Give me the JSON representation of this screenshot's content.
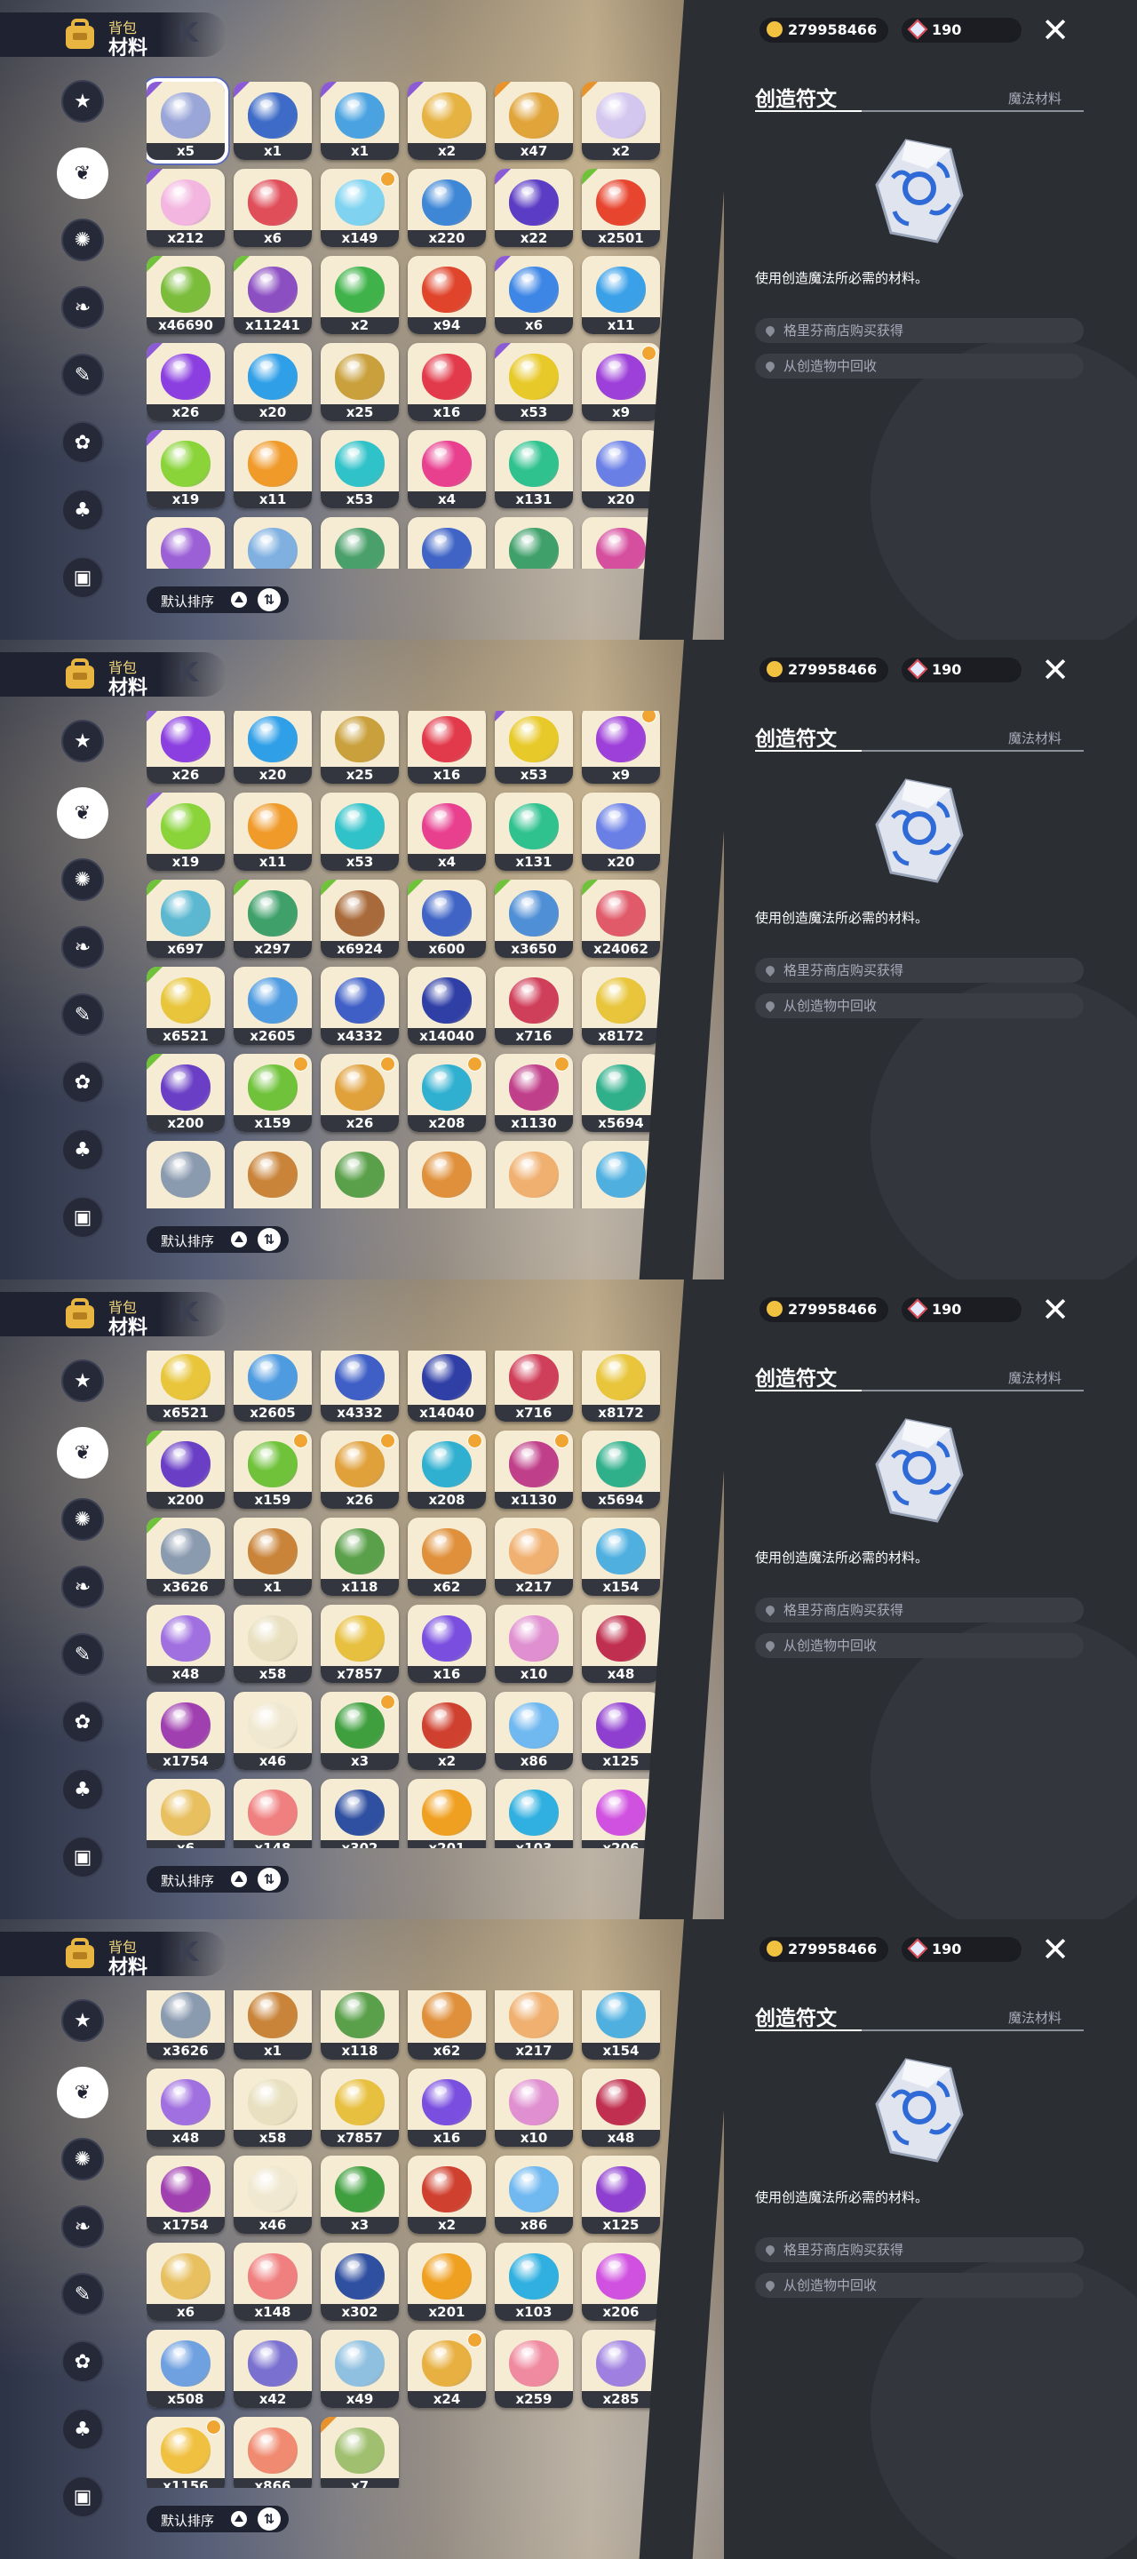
{
  "header": {
    "title_small": "背包",
    "title_main": "材料",
    "title_deco": "K"
  },
  "categories": [
    "star-category-icon",
    "leaf-category-icon",
    "gear-flower-category-icon",
    "plant-category-icon",
    "scroll-category-icon",
    "pet-category-icon",
    "acorn-category-icon",
    "chest-category-icon"
  ],
  "sort": {
    "label": "默认排序"
  },
  "currency": {
    "coins": "279958466",
    "gems": "190"
  },
  "detail": {
    "name": "创造符文",
    "category": "魔法材料",
    "description": "使用创造魔法所必需的材料。",
    "sources": [
      "格里芬商店购买获得",
      "从创造物中回收"
    ]
  },
  "colors": {
    "accent": "#f0c240",
    "panel": "#2b2e33",
    "rarity_purple": "#8b5bd6",
    "rarity_orange": "#e8922c",
    "rarity_green": "#6fc23a"
  },
  "panels": [
    {
      "items": [
        {
          "count": "x5",
          "color": "#9aa6d8",
          "sel": true,
          "rar": "#8b5bd6"
        },
        {
          "count": "x1",
          "color": "#3d6bc7",
          "rar": "#8b5bd6"
        },
        {
          "count": "x1",
          "color": "#4aa3e0",
          "rar": "#8b5bd6"
        },
        {
          "count": "x2",
          "color": "#e6b343",
          "rar": "#8b5bd6"
        },
        {
          "count": "x47",
          "color": "#e0a43a",
          "rar": "#e8922c"
        },
        {
          "count": "x2",
          "color": "#d3c6ef",
          "rar": "#e8922c"
        },
        {
          "count": "x212",
          "color": "#f3b6e0",
          "rar": "#8b5bd6"
        },
        {
          "count": "x6",
          "color": "#e04e5a"
        },
        {
          "count": "x149",
          "color": "#7fd3f0",
          "flag": true
        },
        {
          "count": "x220",
          "color": "#3e86d6"
        },
        {
          "count": "x22",
          "color": "#5b3cc4",
          "rar": "#8b5bd6"
        },
        {
          "count": "x2501",
          "color": "#e8452f",
          "rar": "#6fc23a"
        },
        {
          "count": "x46690",
          "color": "#7bbd3b",
          "rar": "#6fc23a"
        },
        {
          "count": "x11241",
          "color": "#8c4fc2",
          "rar": "#6fc23a"
        },
        {
          "count": "x2",
          "color": "#3fb34a"
        },
        {
          "count": "x94",
          "color": "#e0452c"
        },
        {
          "count": "x6",
          "color": "#3e86e6",
          "rar": "#8b5bd6"
        },
        {
          "count": "x11",
          "color": "#3aa0e8"
        },
        {
          "count": "x26",
          "color": "#8b3fe0",
          "rar": "#8b5bd6"
        },
        {
          "count": "x20",
          "color": "#2f9fe8"
        },
        {
          "count": "x25",
          "color": "#c9a03b"
        },
        {
          "count": "x16",
          "color": "#e23a4a"
        },
        {
          "count": "x53",
          "color": "#e8c92a",
          "rar": "#8b5bd6"
        },
        {
          "count": "x9",
          "color": "#9d3fd9",
          "flag": true
        },
        {
          "count": "x19",
          "color": "#8ad43a",
          "rar": "#8b5bd6"
        },
        {
          "count": "x11",
          "color": "#f09a2a"
        },
        {
          "count": "x53",
          "color": "#2fc2c8"
        },
        {
          "count": "x4",
          "color": "#e83f8f"
        },
        {
          "count": "x131",
          "color": "#2fc28f"
        },
        {
          "count": "x20",
          "color": "#6a7fe6"
        },
        {
          "count": "",
          "color": "#9b5fd6"
        },
        {
          "count": "",
          "color": "#7fb0e0"
        },
        {
          "count": "",
          "color": "#4aa06a"
        },
        {
          "count": "",
          "color": "#3f64c6"
        },
        {
          "count": "",
          "color": "#3fa06a"
        },
        {
          "count": "",
          "color": "#d64f9f"
        }
      ]
    },
    {
      "items": [
        {
          "count": "x26",
          "color": "#8b3fe0",
          "rar": "#8b5bd6"
        },
        {
          "count": "x20",
          "color": "#2f9fe8"
        },
        {
          "count": "x25",
          "color": "#c9a03b"
        },
        {
          "count": "x16",
          "color": "#e23a4a"
        },
        {
          "count": "x53",
          "color": "#e8c92a",
          "rar": "#8b5bd6"
        },
        {
          "count": "x9",
          "color": "#9d3fd9",
          "flag": true
        },
        {
          "count": "x19",
          "color": "#8ad43a",
          "rar": "#8b5bd6"
        },
        {
          "count": "x11",
          "color": "#f09a2a"
        },
        {
          "count": "x53",
          "color": "#2fc2c8"
        },
        {
          "count": "x4",
          "color": "#e83f8f"
        },
        {
          "count": "x131",
          "color": "#2fc28f"
        },
        {
          "count": "x20",
          "color": "#6a7fe6"
        },
        {
          "count": "x697",
          "color": "#5bb8d0",
          "rar": "#6fc23a"
        },
        {
          "count": "x297",
          "color": "#3fa06a",
          "rar": "#6fc23a"
        },
        {
          "count": "x6924",
          "color": "#a86a3a",
          "rar": "#6fc23a"
        },
        {
          "count": "x600",
          "color": "#3f64c6",
          "rar": "#6fc23a"
        },
        {
          "count": "x3650",
          "color": "#4f8fd6",
          "rar": "#6fc23a"
        },
        {
          "count": "x24062",
          "color": "#e05a6a",
          "rar": "#6fc23a"
        },
        {
          "count": "x6521",
          "color": "#e8c53a",
          "rar": "#6fc23a"
        },
        {
          "count": "x2605",
          "color": "#4f9be0"
        },
        {
          "count": "x4332",
          "color": "#3f5fc6"
        },
        {
          "count": "x14040",
          "color": "#2f3fa6"
        },
        {
          "count": "x716",
          "color": "#d03f5a"
        },
        {
          "count": "x8172",
          "color": "#e8c53a"
        },
        {
          "count": "x200",
          "color": "#6a3fc6",
          "rar": "#6fc23a"
        },
        {
          "count": "x159",
          "color": "#6fc23a",
          "flag": true
        },
        {
          "count": "x26",
          "color": "#e0a03a",
          "flag": true
        },
        {
          "count": "x208",
          "color": "#2fb0d0",
          "flag": true
        },
        {
          "count": "x1130",
          "color": "#c03f8a",
          "flag": true
        },
        {
          "count": "x5694",
          "color": "#2fb08a"
        },
        {
          "count": "",
          "color": "#8a9aaf"
        },
        {
          "count": "",
          "color": "#c9843a"
        },
        {
          "count": "",
          "color": "#5aa04a"
        },
        {
          "count": "",
          "color": "#e0903a"
        },
        {
          "count": "",
          "color": "#f0b070"
        },
        {
          "count": "",
          "color": "#4fb0e0"
        }
      ]
    },
    {
      "items": [
        {
          "count": "x6521",
          "color": "#e8c53a"
        },
        {
          "count": "x2605",
          "color": "#4f9be0"
        },
        {
          "count": "x4332",
          "color": "#3f5fc6"
        },
        {
          "count": "x14040",
          "color": "#2f3fa6"
        },
        {
          "count": "x716",
          "color": "#d03f5a"
        },
        {
          "count": "x8172",
          "color": "#e8c53a"
        },
        {
          "count": "x200",
          "color": "#6a3fc6",
          "rar": "#6fc23a"
        },
        {
          "count": "x159",
          "color": "#6fc23a",
          "flag": true
        },
        {
          "count": "x26",
          "color": "#e0a03a",
          "flag": true
        },
        {
          "count": "x208",
          "color": "#2fb0d0",
          "flag": true
        },
        {
          "count": "x1130",
          "color": "#c03f8a",
          "flag": true
        },
        {
          "count": "x5694",
          "color": "#2fb08a"
        },
        {
          "count": "x3626",
          "color": "#8a9aaf",
          "rar": "#6fc23a"
        },
        {
          "count": "x1",
          "color": "#c9843a"
        },
        {
          "count": "x118",
          "color": "#5aa04a"
        },
        {
          "count": "x62",
          "color": "#e0903a"
        },
        {
          "count": "x217",
          "color": "#f0b070"
        },
        {
          "count": "x154",
          "color": "#4fb0e0"
        },
        {
          "count": "x48",
          "color": "#a070e0"
        },
        {
          "count": "x58",
          "color": "#e8e0c0"
        },
        {
          "count": "x7857",
          "color": "#e8c040"
        },
        {
          "count": "x16",
          "color": "#7a4fe0"
        },
        {
          "count": "x10",
          "color": "#e090d0"
        },
        {
          "count": "x48",
          "color": "#c02f4f"
        },
        {
          "count": "x1754",
          "color": "#a040b0"
        },
        {
          "count": "x46",
          "color": "#f0e8d0"
        },
        {
          "count": "x3",
          "color": "#3f9f3f",
          "flag": true
        },
        {
          "count": "x2",
          "color": "#d0402f"
        },
        {
          "count": "x86",
          "color": "#70b8f0"
        },
        {
          "count": "x125",
          "color": "#8f3fd0"
        },
        {
          "count": "x6",
          "color": "#e8c060"
        },
        {
          "count": "x148",
          "color": "#f08080"
        },
        {
          "count": "x302",
          "color": "#2f4fa0"
        },
        {
          "count": "x201",
          "color": "#f0a020"
        },
        {
          "count": "x103",
          "color": "#30b0e0"
        },
        {
          "count": "x206",
          "color": "#d050e0"
        }
      ]
    },
    {
      "items": [
        {
          "count": "x3626",
          "color": "#8a9aaf"
        },
        {
          "count": "x1",
          "color": "#c9843a"
        },
        {
          "count": "x118",
          "color": "#5aa04a"
        },
        {
          "count": "x62",
          "color": "#e0903a"
        },
        {
          "count": "x217",
          "color": "#f0b070"
        },
        {
          "count": "x154",
          "color": "#4fb0e0"
        },
        {
          "count": "x48",
          "color": "#a070e0"
        },
        {
          "count": "x58",
          "color": "#e8e0c0"
        },
        {
          "count": "x7857",
          "color": "#e8c040"
        },
        {
          "count": "x16",
          "color": "#7a4fe0"
        },
        {
          "count": "x10",
          "color": "#e090d0"
        },
        {
          "count": "x48",
          "color": "#c02f4f"
        },
        {
          "count": "x1754",
          "color": "#a040b0"
        },
        {
          "count": "x46",
          "color": "#f0e8d0"
        },
        {
          "count": "x3",
          "color": "#3f9f3f"
        },
        {
          "count": "x2",
          "color": "#d0402f"
        },
        {
          "count": "x86",
          "color": "#70b8f0"
        },
        {
          "count": "x125",
          "color": "#8f3fd0"
        },
        {
          "count": "x6",
          "color": "#e8c060"
        },
        {
          "count": "x148",
          "color": "#f08080"
        },
        {
          "count": "x302",
          "color": "#2f4fa0"
        },
        {
          "count": "x201",
          "color": "#f0a020"
        },
        {
          "count": "x103",
          "color": "#30b0e0"
        },
        {
          "count": "x206",
          "color": "#d050e0"
        },
        {
          "count": "x508",
          "color": "#6fa0e0"
        },
        {
          "count": "x42",
          "color": "#7a70d0"
        },
        {
          "count": "x49",
          "color": "#8fc0e0"
        },
        {
          "count": "x24",
          "color": "#e8b040",
          "flag": true
        },
        {
          "count": "x259",
          "color": "#f08aa0"
        },
        {
          "count": "x285",
          "color": "#9f80e0"
        },
        {
          "count": "x1156",
          "color": "#f0c040",
          "flag": true
        },
        {
          "count": "x866",
          "color": "#f08a70"
        },
        {
          "count": "x7",
          "color": "#a0c070",
          "rar": "#e8922c"
        }
      ]
    }
  ]
}
